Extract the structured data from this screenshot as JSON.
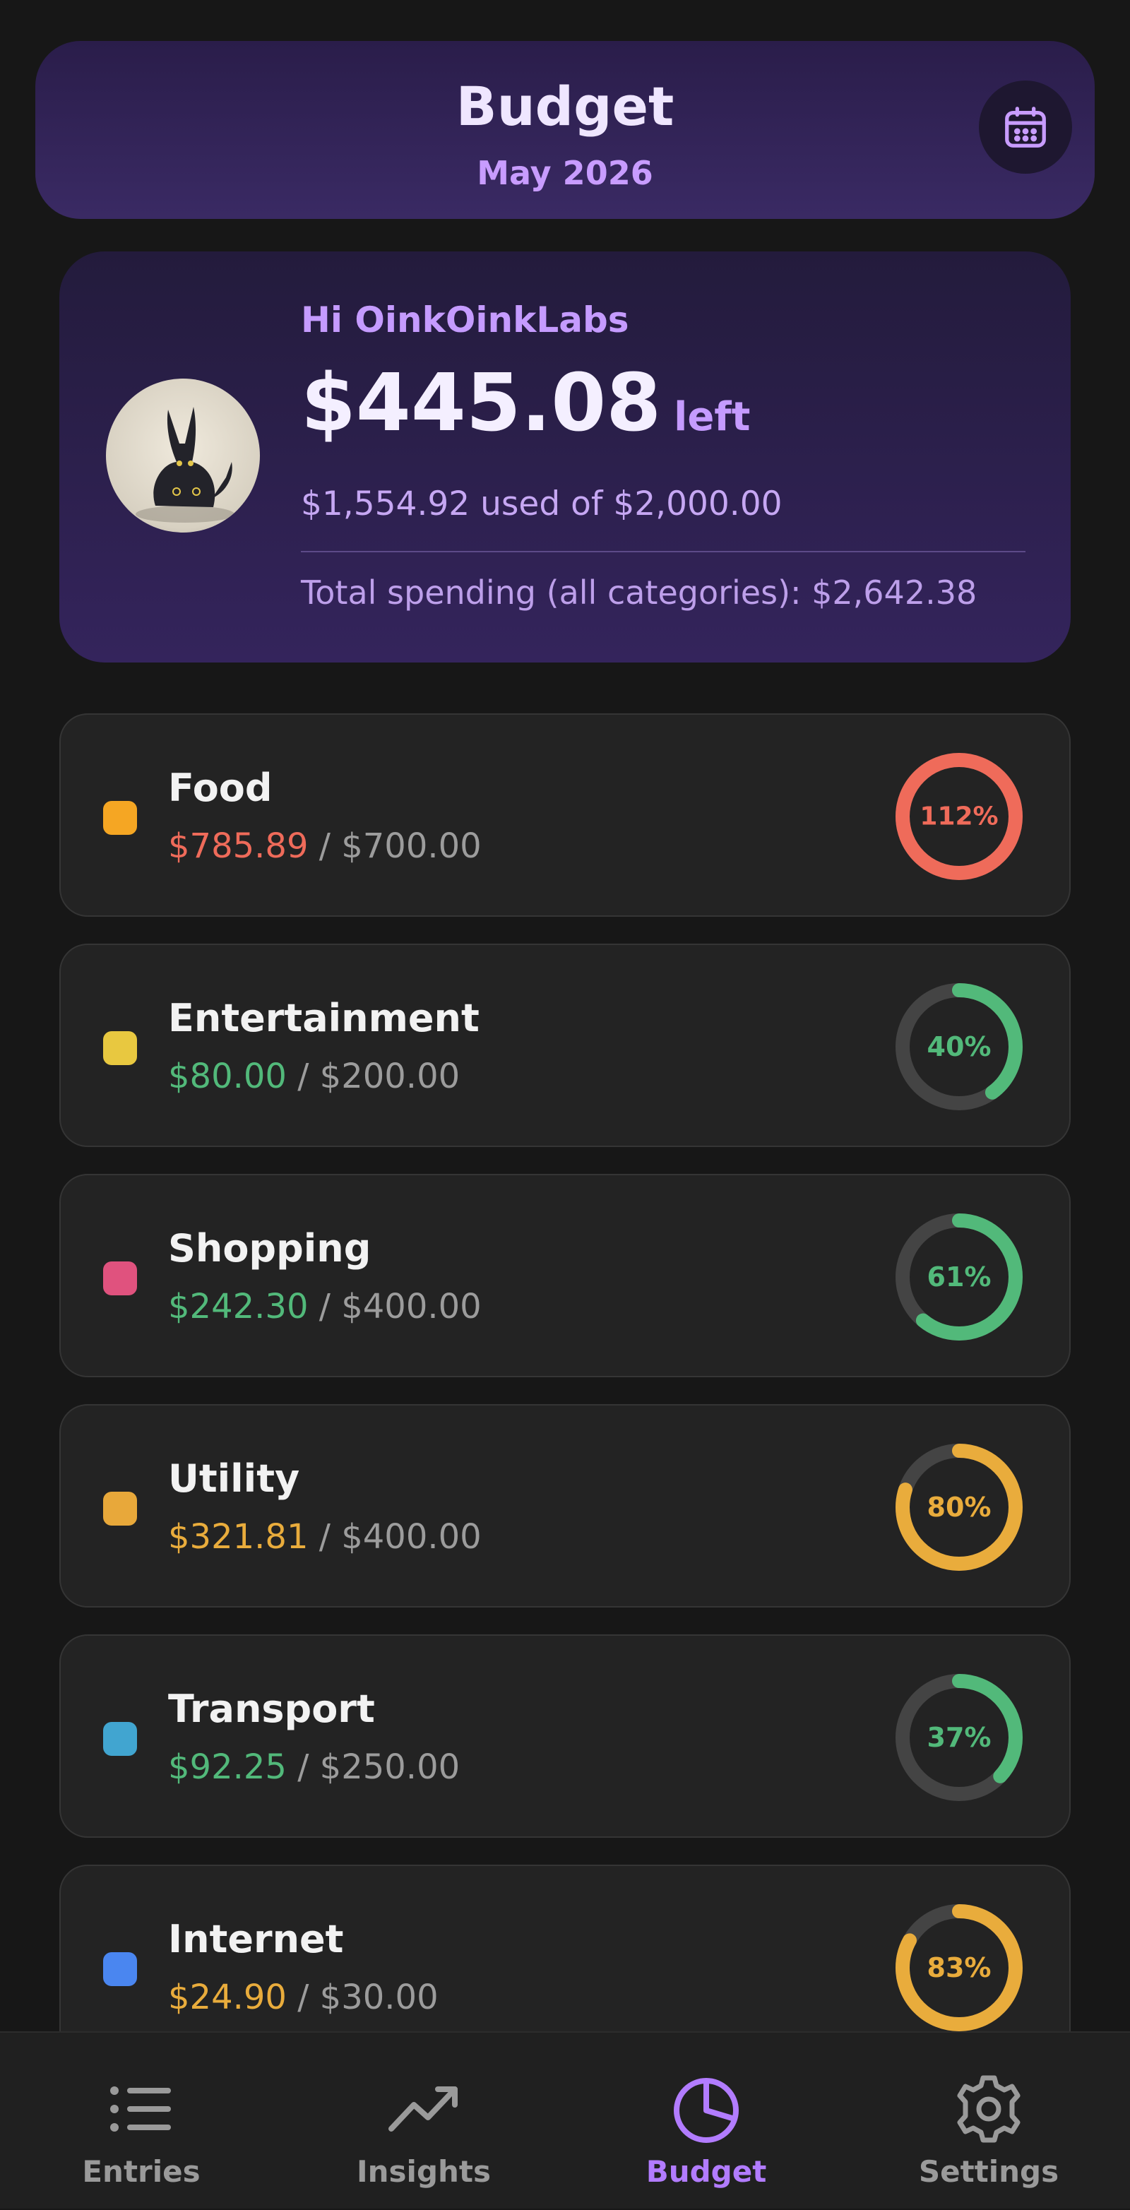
{
  "header": {
    "title": "Budget",
    "subtitle": "May 2026",
    "calendar_icon": "calendar-icon"
  },
  "summary": {
    "greeting": "Hi OinkOinkLabs",
    "remaining": "$445.08",
    "remaining_suffix": "left",
    "used_text": "$1,554.92 used of $2,000.00",
    "total_text": "Total spending (all categories): $2,642.38"
  },
  "colors": {
    "over": "#ef6b5a",
    "ok": "#52b97a",
    "warn": "#e9ac3c",
    "track": "#444444",
    "accent": "#b27cff"
  },
  "categories": [
    {
      "name": "Food",
      "spent": "$785.89",
      "budget": "/ $700.00",
      "percent_label": "112%",
      "percent": 112,
      "status": "over",
      "dot_color": "#f5a623"
    },
    {
      "name": "Entertainment",
      "spent": "$80.00",
      "budget": "/ $200.00",
      "percent_label": "40%",
      "percent": 40,
      "status": "ok",
      "dot_color": "#e8c840"
    },
    {
      "name": "Shopping",
      "spent": "$242.30",
      "budget": "/ $400.00",
      "percent_label": "61%",
      "percent": 61,
      "status": "ok",
      "dot_color": "#e0527e"
    },
    {
      "name": "Utility",
      "spent": "$321.81",
      "budget": "/ $400.00",
      "percent_label": "80%",
      "percent": 80,
      "status": "warn",
      "dot_color": "#e8a83a"
    },
    {
      "name": "Transport",
      "spent": "$92.25",
      "budget": "/ $250.00",
      "percent_label": "37%",
      "percent": 37,
      "status": "ok",
      "dot_color": "#41a5d0"
    },
    {
      "name": "Internet",
      "spent": "$24.90",
      "budget": "/ $30.00",
      "percent_label": "83%",
      "percent": 83,
      "status": "warn",
      "dot_color": "#4a86f0"
    }
  ],
  "nav": [
    {
      "label": "Entries",
      "icon": "list-icon",
      "active": false
    },
    {
      "label": "Insights",
      "icon": "trend-icon",
      "active": false
    },
    {
      "label": "Budget",
      "icon": "pie-chart-icon",
      "active": true
    },
    {
      "label": "Settings",
      "icon": "gear-icon",
      "active": false
    }
  ]
}
